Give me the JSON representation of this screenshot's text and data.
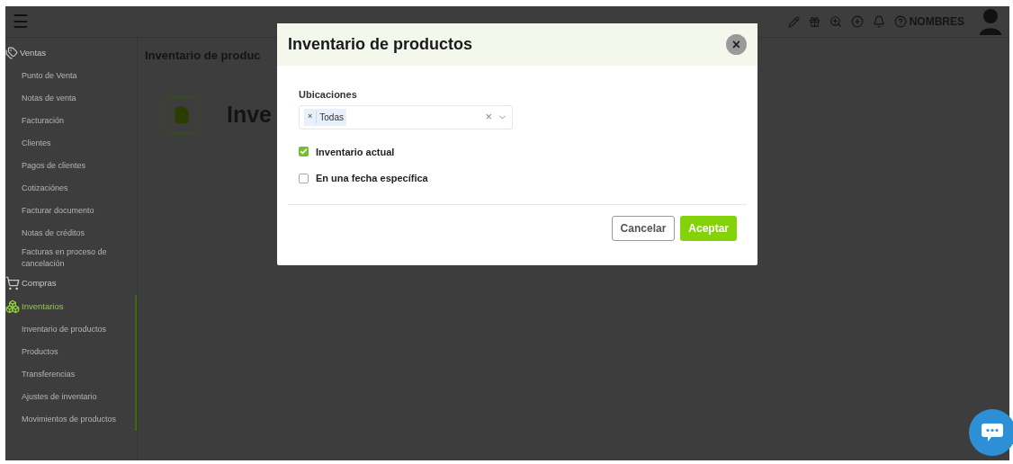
{
  "topbar": {
    "menu_glyph": "☰",
    "user_label": "NOMBRES"
  },
  "sidebar": {
    "sections": [
      {
        "kind": "ventas",
        "label": "Ventas",
        "active": false,
        "items": [
          "Punto de Venta",
          "Notas de venta",
          "Facturación",
          "Clientes",
          "Pagos de clientes",
          "Cotizaciónes",
          "Facturar documento",
          "Notas de créditos",
          "Facturas en proceso de cancelación"
        ]
      },
      {
        "kind": "compras",
        "label": "Compras",
        "active": false
      },
      {
        "kind": "inventarios",
        "label": "Inventarios",
        "active": true,
        "items": [
          "Inventario de productos",
          "Productos",
          "Transferencias",
          "Ajustes de inventario",
          "Movimientos de productos"
        ]
      }
    ]
  },
  "main": {
    "title": "Inventario de produc",
    "heading": "Inve"
  },
  "modal": {
    "title": "Inventario de productos",
    "close_glyph": "×",
    "locations": {
      "label": "Ubicaciones",
      "tags": [
        {
          "remove_glyph": "×",
          "label": "Todas"
        }
      ],
      "clear_glyph": "×"
    },
    "options": [
      {
        "label": "Inventario actual",
        "checked": true
      },
      {
        "label": "En una fecha específica",
        "checked": false
      }
    ],
    "buttons": [
      {
        "kind": "secondary",
        "label": "Cancelar"
      },
      {
        "kind": "primary",
        "label": "Aceptar"
      }
    ]
  }
}
